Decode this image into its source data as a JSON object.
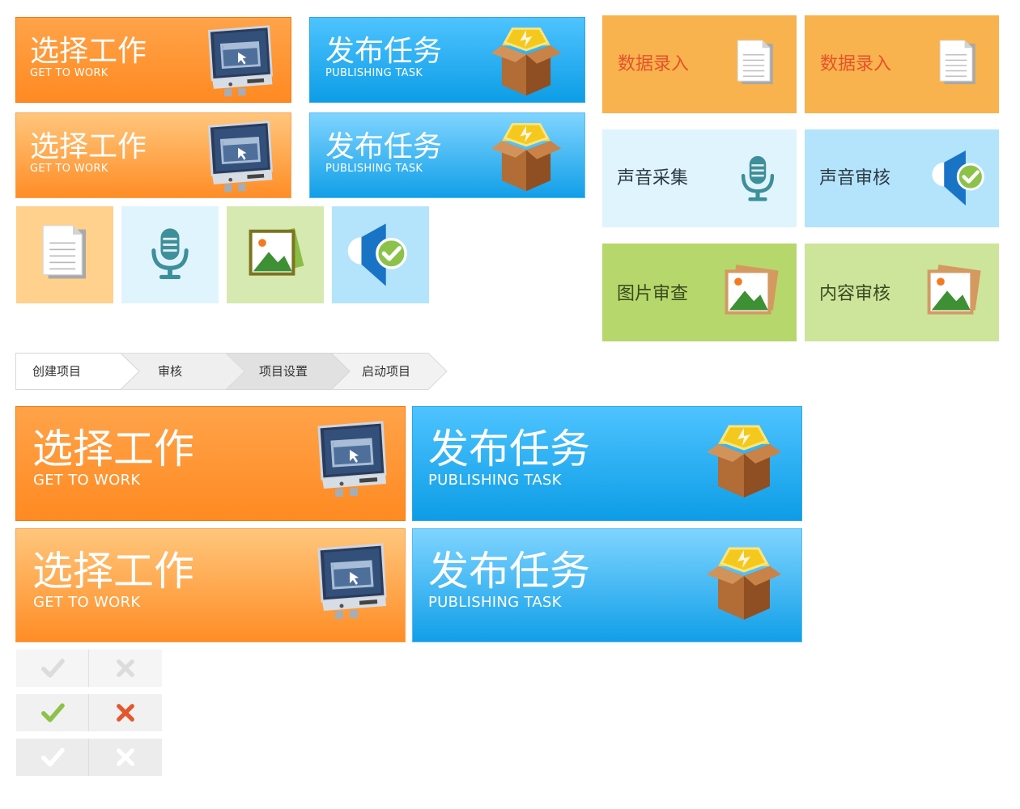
{
  "tiles": {
    "work_title": "选择工作",
    "work_sub": "GET TO WORK",
    "task_title": "发布任务",
    "task_sub": "PUBLISHING TASK"
  },
  "cards": {
    "data_entry": "数据录入",
    "voice_collect": "声音采集",
    "voice_review": "声音审核",
    "image_review": "图片审查",
    "content_review": "内容审核"
  },
  "steps": [
    "创建项目",
    "审核",
    "项目设置",
    "启动项目"
  ],
  "colors": {
    "orange": "#ff8a22",
    "blue": "#0d9de6",
    "card_orange": "#f8b24e",
    "card_light_blue": "#e0f4fd",
    "card_blue": "#b3e4fb",
    "card_green": "#b6d76b",
    "card_light_green": "#cde49b",
    "label_red": "#e4532a",
    "label_dark": "#2e3a45",
    "label_green_dark": "#3a4a20",
    "check_green": "#8cc24a",
    "cross_red": "#e4572e"
  },
  "icons": [
    "monitor-icon",
    "package-box-icon",
    "document-icon",
    "microphone-icon",
    "image-icon",
    "speaker-check-icon",
    "check-icon",
    "cross-icon"
  ]
}
